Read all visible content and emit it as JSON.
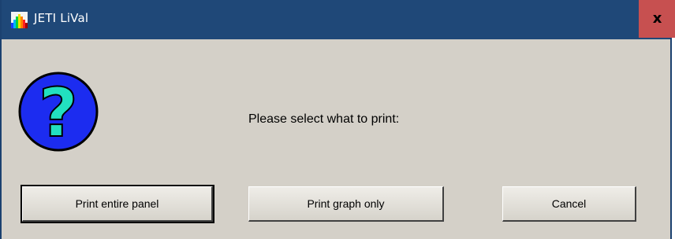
{
  "window": {
    "title": "JETI LiVal",
    "close_glyph": "x",
    "icon": "app-spectrum-icon"
  },
  "dialog": {
    "icon": "question-icon",
    "icon_glyph": "?",
    "message": "Please select what to print:"
  },
  "buttons": {
    "print_entire_panel": "Print entire panel",
    "print_graph_only": "Print graph only",
    "cancel": "Cancel"
  },
  "colors": {
    "titlebar": "#1f4878",
    "close_button": "#c75050",
    "dialog_background": "#d4d0c8",
    "question_icon_fill": "#1c2cf0",
    "question_mark": "#22e0c0"
  }
}
